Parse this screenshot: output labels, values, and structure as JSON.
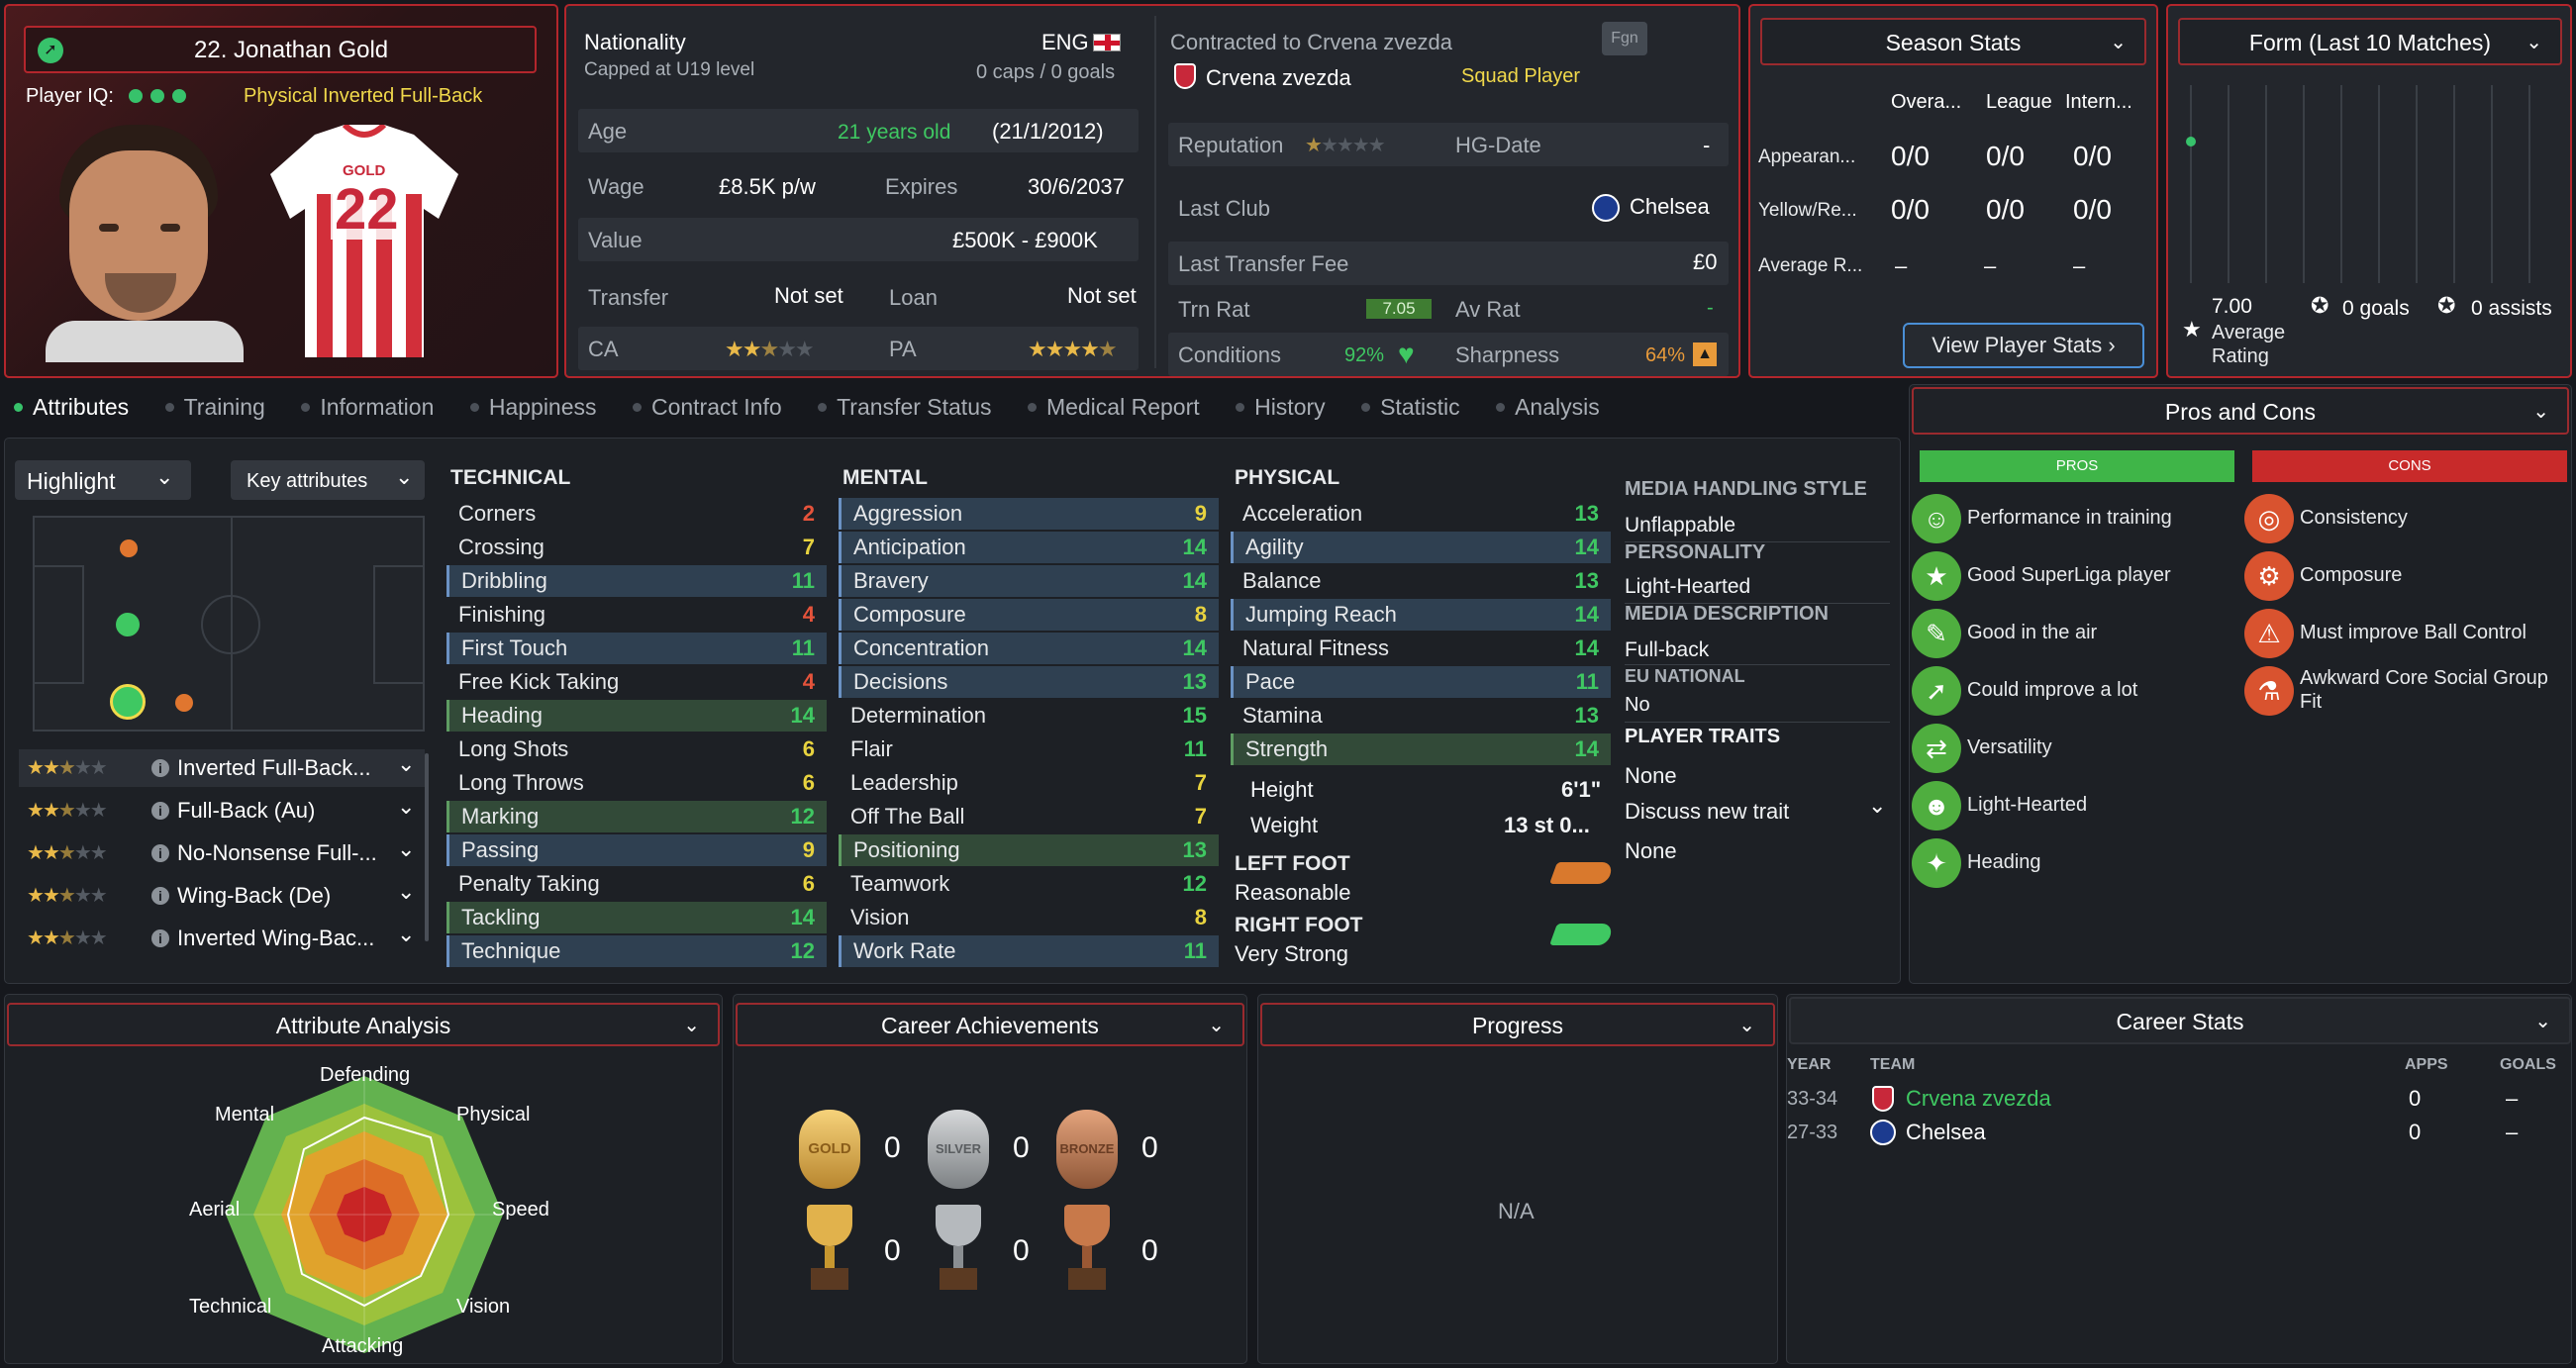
{
  "player": {
    "name": "22. Jonathan Gold",
    "iq_label": "Player IQ:",
    "role_badge": "Physical  Inverted Full-Back",
    "shirt_name": "GOLD",
    "shirt_number": "22"
  },
  "info": {
    "nationality_label": "Nationality",
    "nationality_value": "ENG",
    "capped": "Capped at U19 level",
    "caps": "0 caps / 0 goals",
    "age_label": "Age",
    "age_value": "21 years old",
    "dob": "(21/1/2012)",
    "wage_label": "Wage",
    "wage_value": "£8.5K p/w",
    "expires_label": "Expires",
    "expires_value": "30/6/2037",
    "value_label": "Value",
    "value_value": "£500K - £900K",
    "transfer_label": "Transfer",
    "transfer_value": "Not set",
    "loan_label": "Loan",
    "loan_value": "Not set",
    "ca_label": "CA",
    "pa_label": "PA"
  },
  "contract": {
    "contracted": "Contracted to Crvena zvezda",
    "club": "Crvena zvezda",
    "squad_status": "Squad Player",
    "fgn": "Fgn",
    "reputation_label": "Reputation",
    "hg_label": "HG-Date",
    "hg_value": "-",
    "last_club_label": "Last Club",
    "last_club_value": "Chelsea",
    "last_fee_label": "Last Transfer Fee",
    "last_fee_value": "£0",
    "trn_label": "Trn Rat",
    "trn_value": "7.05",
    "av_label": "Av Rat",
    "av_value": "-",
    "cond_label": "Conditions",
    "cond_value": "92%",
    "sharp_label": "Sharpness",
    "sharp_value": "64%"
  },
  "season": {
    "title": "Season Stats",
    "cols": [
      "Overa...",
      "League",
      "Intern..."
    ],
    "rows": [
      {
        "label": "Appearan...",
        "v": [
          "0/0",
          "0/0",
          "0/0"
        ]
      },
      {
        "label": "Yellow/Re...",
        "v": [
          "0/0",
          "0/0",
          "0/0"
        ]
      },
      {
        "label": "Average R...",
        "v": [
          "–",
          "–",
          "–"
        ]
      }
    ],
    "button": "View Player Stats ›"
  },
  "form": {
    "title": "Form (Last 10 Matches)",
    "rating": "7.00",
    "rating_label": "Average Rating",
    "goals": "0 goals",
    "assists": "0 assists"
  },
  "tabs": [
    "Attributes",
    "Training",
    "Information",
    "Happiness",
    "Contract Info",
    "Transfer Status",
    "Medical Report",
    "History",
    "Statistic",
    "Analysis"
  ],
  "controls": {
    "highlight": "Highlight",
    "key_attrs": "Key attributes"
  },
  "roles": [
    {
      "name": "Inverted Full-Back...",
      "stars": 2.5
    },
    {
      "name": "Full-Back (Au)",
      "stars": 2.5
    },
    {
      "name": "No-Nonsense Full-...",
      "stars": 2.5
    },
    {
      "name": "Wing-Back (De)",
      "stars": 2.5
    },
    {
      "name": "Inverted Wing-Bac...",
      "stars": 2.5
    }
  ],
  "technical": {
    "title": "TECHNICAL",
    "items": [
      {
        "n": "Corners",
        "v": "2",
        "c": "red",
        "h": ""
      },
      {
        "n": "Crossing",
        "v": "7",
        "c": "yel",
        "h": ""
      },
      {
        "n": "Dribbling",
        "v": "11",
        "c": "grn",
        "h": "blue"
      },
      {
        "n": "Finishing",
        "v": "4",
        "c": "red",
        "h": ""
      },
      {
        "n": "First Touch",
        "v": "11",
        "c": "grn",
        "h": "blue"
      },
      {
        "n": "Free Kick Taking",
        "v": "4",
        "c": "red",
        "h": ""
      },
      {
        "n": "Heading",
        "v": "14",
        "c": "grn",
        "h": "green"
      },
      {
        "n": "Long Shots",
        "v": "6",
        "c": "yel",
        "h": ""
      },
      {
        "n": "Long Throws",
        "v": "6",
        "c": "yel",
        "h": ""
      },
      {
        "n": "Marking",
        "v": "12",
        "c": "grn",
        "h": "green"
      },
      {
        "n": "Passing",
        "v": "9",
        "c": "yel",
        "h": "blue"
      },
      {
        "n": "Penalty Taking",
        "v": "6",
        "c": "yel",
        "h": ""
      },
      {
        "n": "Tackling",
        "v": "14",
        "c": "grn",
        "h": "green"
      },
      {
        "n": "Technique",
        "v": "12",
        "c": "grn",
        "h": "blue"
      }
    ]
  },
  "mental": {
    "title": "MENTAL",
    "items": [
      {
        "n": "Aggression",
        "v": "9",
        "c": "yel",
        "h": "blue"
      },
      {
        "n": "Anticipation",
        "v": "14",
        "c": "grn",
        "h": "blue"
      },
      {
        "n": "Bravery",
        "v": "14",
        "c": "grn",
        "h": "blue"
      },
      {
        "n": "Composure",
        "v": "8",
        "c": "yel",
        "h": "blue"
      },
      {
        "n": "Concentration",
        "v": "14",
        "c": "grn",
        "h": "blue"
      },
      {
        "n": "Decisions",
        "v": "13",
        "c": "grn",
        "h": "blue"
      },
      {
        "n": "Determination",
        "v": "15",
        "c": "grn",
        "h": ""
      },
      {
        "n": "Flair",
        "v": "11",
        "c": "grn",
        "h": ""
      },
      {
        "n": "Leadership",
        "v": "7",
        "c": "yel",
        "h": ""
      },
      {
        "n": "Off The Ball",
        "v": "7",
        "c": "yel",
        "h": ""
      },
      {
        "n": "Positioning",
        "v": "13",
        "c": "grn",
        "h": "green"
      },
      {
        "n": "Teamwork",
        "v": "12",
        "c": "grn",
        "h": ""
      },
      {
        "n": "Vision",
        "v": "8",
        "c": "yel",
        "h": ""
      },
      {
        "n": "Work Rate",
        "v": "11",
        "c": "grn",
        "h": "blue"
      }
    ]
  },
  "physical": {
    "title": "PHYSICAL",
    "items": [
      {
        "n": "Acceleration",
        "v": "13",
        "c": "grn",
        "h": ""
      },
      {
        "n": "Agility",
        "v": "14",
        "c": "grn",
        "h": "blue"
      },
      {
        "n": "Balance",
        "v": "13",
        "c": "grn",
        "h": ""
      },
      {
        "n": "Jumping Reach",
        "v": "14",
        "c": "grn",
        "h": "blue"
      },
      {
        "n": "Natural Fitness",
        "v": "14",
        "c": "grn",
        "h": ""
      },
      {
        "n": "Pace",
        "v": "11",
        "c": "grn",
        "h": "blue"
      },
      {
        "n": "Stamina",
        "v": "13",
        "c": "grn",
        "h": ""
      },
      {
        "n": "Strength",
        "v": "14",
        "c": "grn",
        "h": "green"
      }
    ],
    "height_label": "Height",
    "height_value": "6'1\"",
    "weight_label": "Weight",
    "weight_value": "13 st 0...",
    "left_foot_label": "LEFT FOOT",
    "left_foot_value": "Reasonable",
    "right_foot_label": "RIGHT FOOT",
    "right_foot_value": "Very Strong"
  },
  "media": {
    "mhs_label": "MEDIA HANDLING STYLE",
    "mhs_value": "Unflappable",
    "pers_label": "PERSONALITY",
    "pers_value": "Light-Hearted",
    "desc_label": "MEDIA DESCRIPTION",
    "desc_value": "Full-back",
    "eu_label": "EU NATIONAL",
    "eu_value": "No",
    "traits_label": "PLAYER TRAITS",
    "traits_value": "None",
    "discuss": "Discuss new trait",
    "discuss_value": "None"
  },
  "pros_cons": {
    "title": "Pros and Cons",
    "pros_label": "PROS",
    "cons_label": "CONS",
    "pros": [
      "Performance in training",
      "Good SuperLiga player",
      "Good in the air",
      "Could improve a lot",
      "Versatility",
      "Light-Hearted",
      "Heading"
    ],
    "cons": [
      "Consistency",
      "Composure",
      "Must improve Ball Control",
      "Awkward Core Social Group Fit"
    ]
  },
  "analysis": {
    "title": "Attribute Analysis",
    "labels": [
      "Defending",
      "Physical",
      "Speed",
      "Vision",
      "Attacking",
      "Technical",
      "Aerial",
      "Mental"
    ]
  },
  "achievements": {
    "title": "Career Achievements",
    "medal_labels": [
      "GOLD",
      "SILVER",
      "BRONZE"
    ],
    "counts": [
      "0",
      "0",
      "0",
      "0",
      "0",
      "0"
    ]
  },
  "progress": {
    "title": "Progress",
    "value": "N/A"
  },
  "career": {
    "title": "Career Stats",
    "cols": [
      "YEAR",
      "TEAM",
      "APPS",
      "GOALS"
    ],
    "rows": [
      {
        "year": "33-34",
        "team": "Crvena zvezda",
        "apps": "0",
        "goals": "–"
      },
      {
        "year": "27-33",
        "team": "Chelsea",
        "apps": "0",
        "goals": "–"
      }
    ]
  },
  "colors": {
    "accent_red": "#b3262c",
    "green": "#3fc862",
    "yellow": "#e8d33f",
    "attr_red": "#e5533b"
  }
}
